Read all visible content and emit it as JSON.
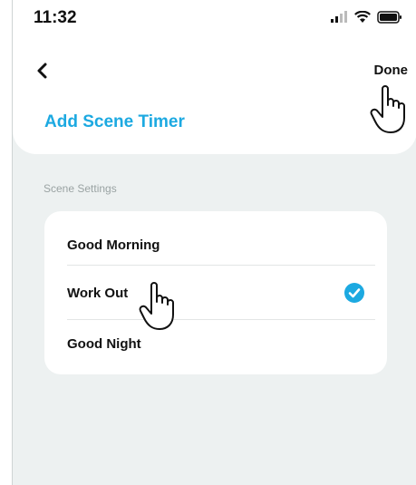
{
  "status_bar": {
    "time": "11:32",
    "icons": [
      "cellular-signal-icon",
      "wifi-icon",
      "battery-icon"
    ]
  },
  "header": {
    "back_icon": "chevron-left-icon",
    "done_label": "Done",
    "title": "Add Scene Timer"
  },
  "section": {
    "label": "Scene Settings"
  },
  "scenes": [
    {
      "label": "Good Morning",
      "selected": false
    },
    {
      "label": "Work Out",
      "selected": true
    },
    {
      "label": "Good Night",
      "selected": false
    }
  ],
  "colors": {
    "accent": "#1ca9e1",
    "background": "#edf1f1",
    "card": "#ffffff"
  },
  "cursors": [
    "hand-pointer-icon",
    "hand-pointer-icon"
  ]
}
